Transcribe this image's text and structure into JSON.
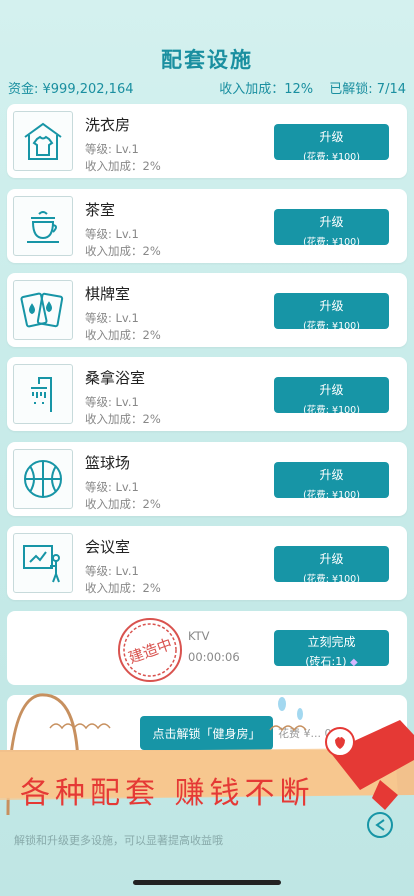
{
  "title": "配套设施",
  "stats": {
    "funds": "资金: ¥999,202,164",
    "income_bonus": "收入加成：12%",
    "unlocked": "已解锁: 7/14"
  },
  "facilities": [
    {
      "name": "洗衣房",
      "level": "等级: Lv.1",
      "income": "收入加成：2%",
      "btn": "升级",
      "cost": "(花费: ¥100)",
      "icon": "laundry-shirt-icon"
    },
    {
      "name": "茶室",
      "level": "等级: Lv.1",
      "income": "收入加成：2%",
      "btn": "升级",
      "cost": "(花费: ¥100)",
      "icon": "tea-cup-icon"
    },
    {
      "name": "棋牌室",
      "level": "等级: Lv.1",
      "income": "收入加成：2%",
      "btn": "升级",
      "cost": "(花费: ¥100)",
      "icon": "playing-cards-icon"
    },
    {
      "name": "桑拿浴室",
      "level": "等级: Lv.1",
      "income": "收入加成：2%",
      "btn": "升级",
      "cost": "(花费: ¥100)",
      "icon": "shower-icon"
    },
    {
      "name": "篮球场",
      "level": "等级: Lv.1",
      "income": "收入加成：2%",
      "btn": "升级",
      "cost": "(花费: ¥100)",
      "icon": "basketball-icon"
    },
    {
      "name": "会议室",
      "level": "等级: Lv.1",
      "income": "收入加成：2%",
      "btn": "升级",
      "cost": "(花费: ¥100)",
      "icon": "presentation-board-icon"
    }
  ],
  "building": {
    "stamp": "建造中",
    "name": "KTV",
    "timer": "00:00:06",
    "btn": "立刻完成",
    "cost": "(砖石:1)"
  },
  "unlock": {
    "btn": "点击解锁「健身房」",
    "cost": "花费 ¥... 000"
  },
  "banner": {
    "text": "各种配套 赚钱不断"
  },
  "footer": "解锁和升级更多设施，可以显著提高收益哦",
  "colors": {
    "accent": "#1795a6",
    "title": "#1a8fa0",
    "banner_red": "#e53935",
    "background": "#c9ecea"
  }
}
